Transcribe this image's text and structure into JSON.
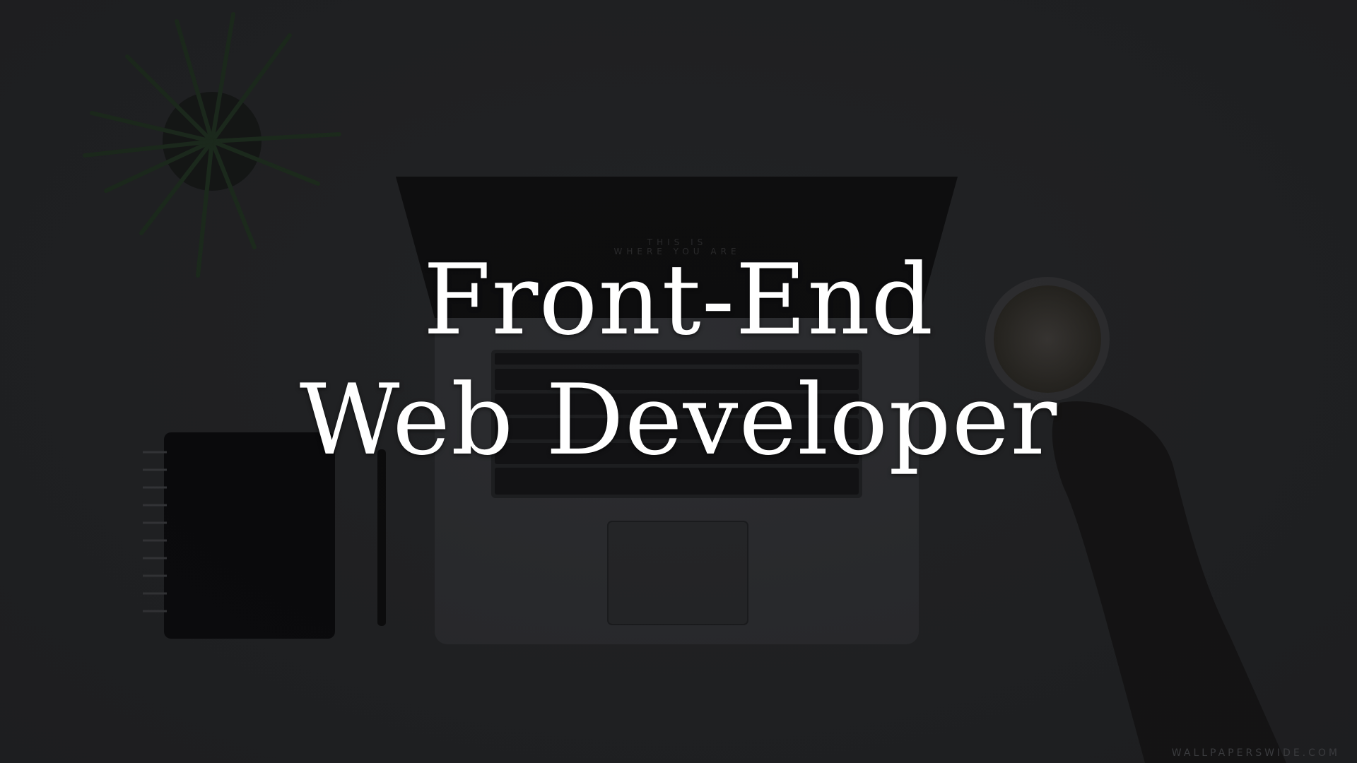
{
  "headline": {
    "line1": "Front-End",
    "line2": "Web Developer"
  },
  "screen_text": {
    "line1": "THIS IS",
    "line2": "WHERE YOU ARE"
  },
  "watermark": "WALLPAPERSWIDE.COM",
  "colors": {
    "background": "#222325",
    "headline": "#ffffff",
    "laptop_body": "#2c2d30",
    "laptop_screen": "#0d0d0e",
    "notebook": "#08080a",
    "plant": "#1f3520"
  }
}
